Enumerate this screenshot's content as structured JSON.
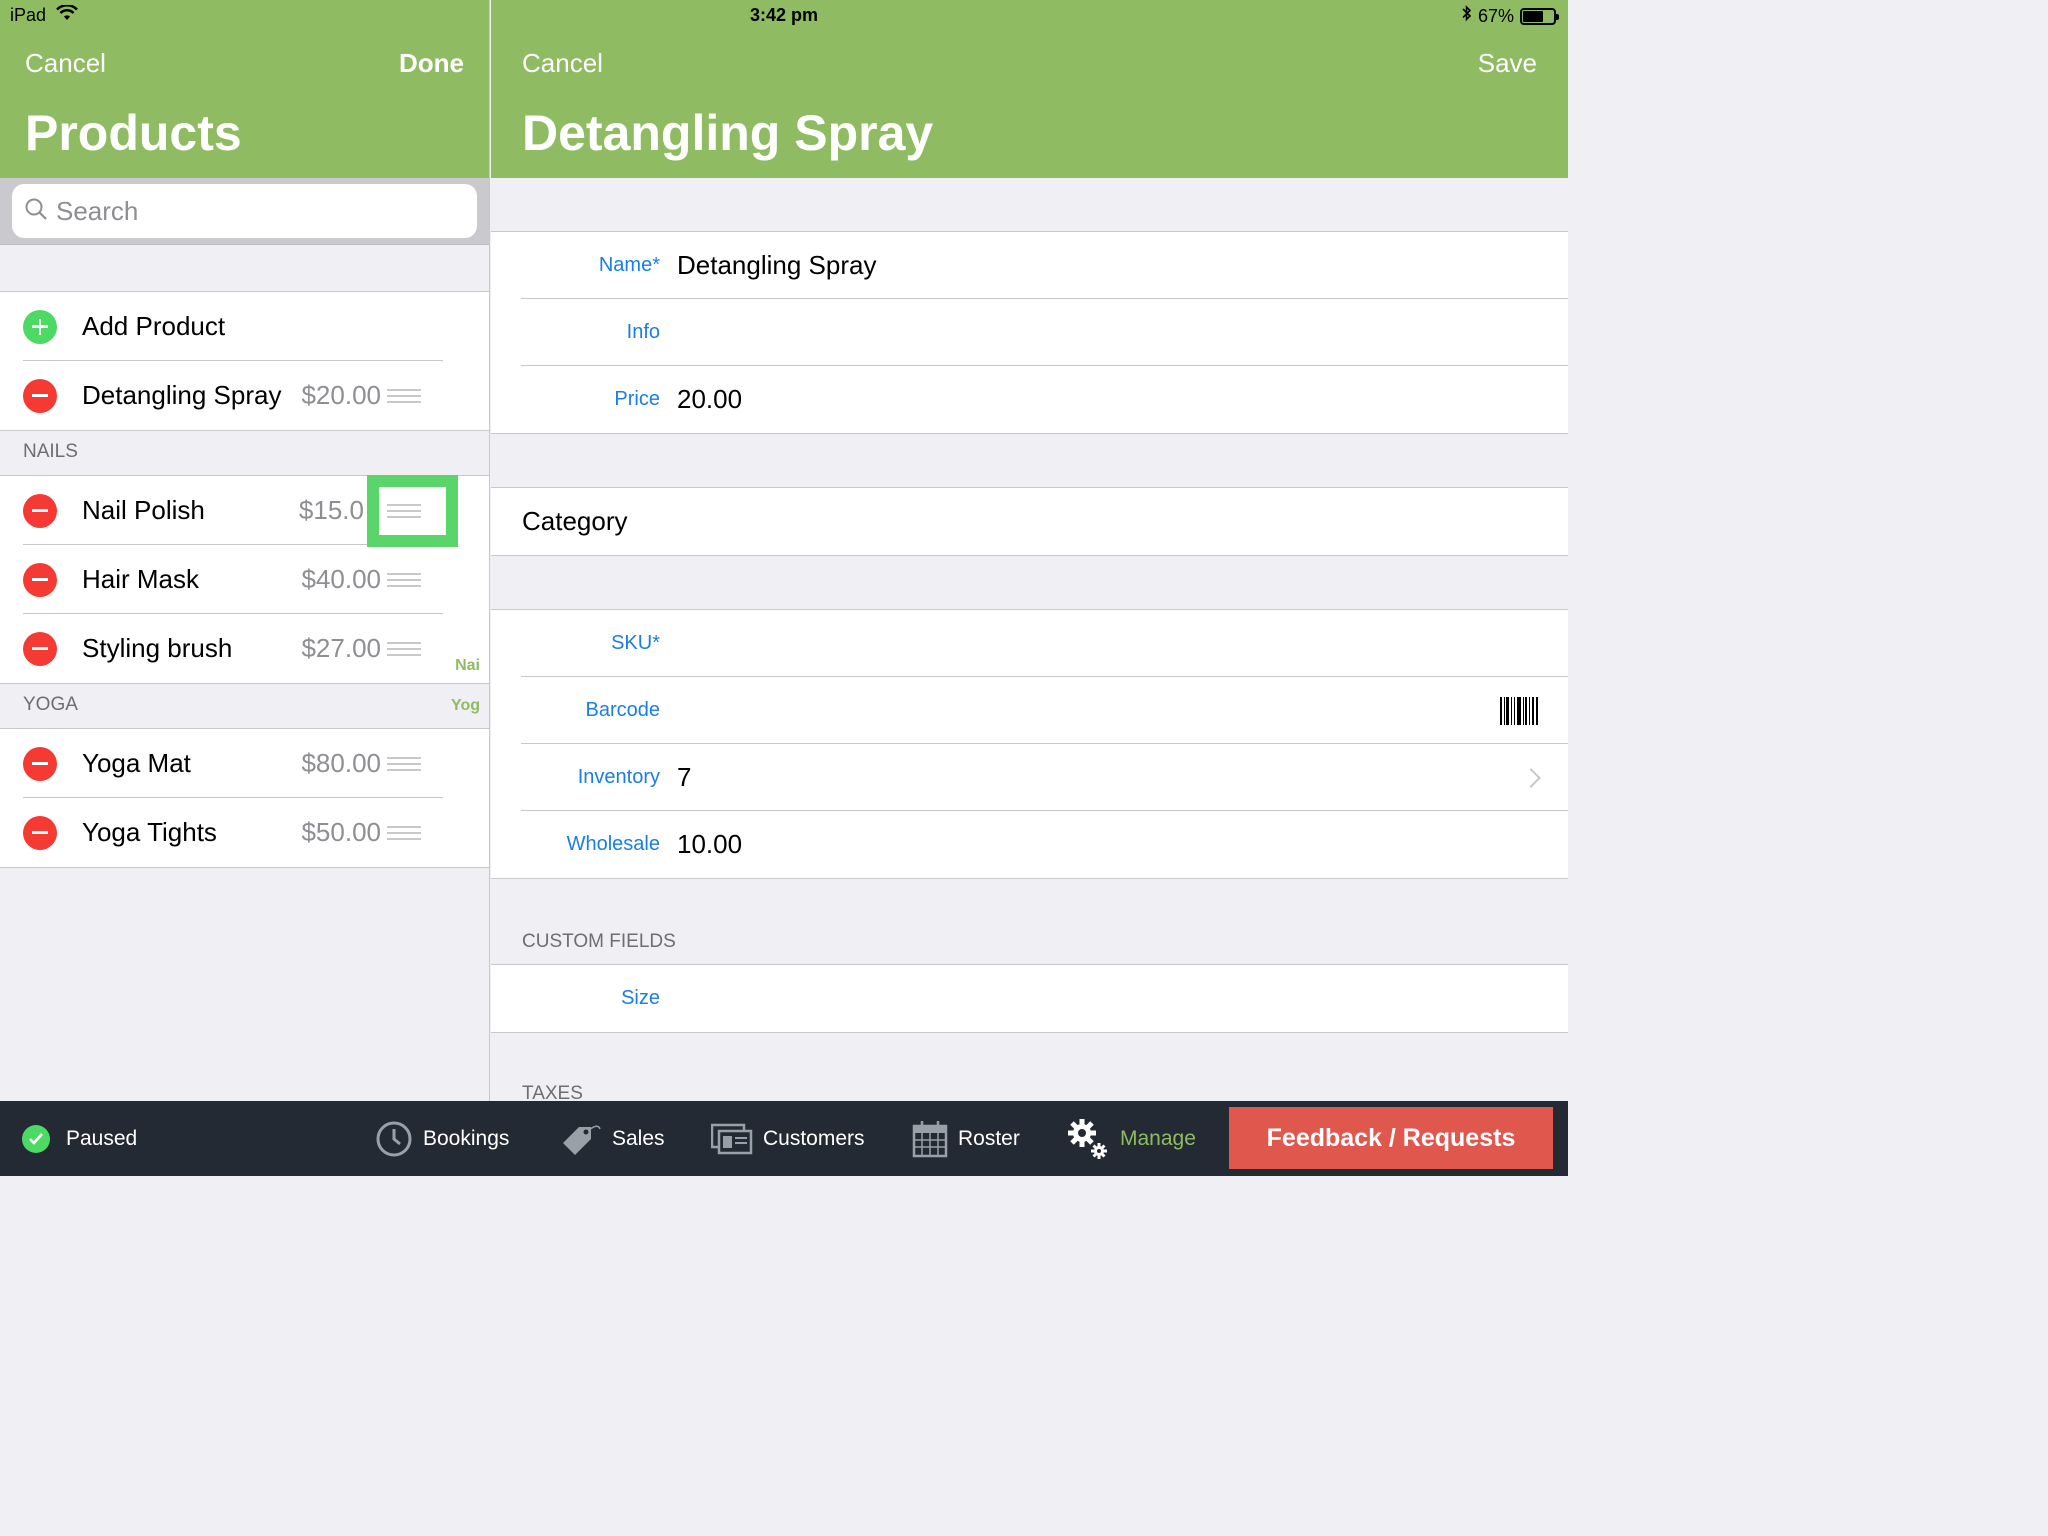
{
  "status_bar": {
    "device": "iPad",
    "time": "3:42 pm",
    "battery": "67%",
    "battery_level": 0.67
  },
  "left": {
    "cancel": "Cancel",
    "done": "Done",
    "title": "Products",
    "search_placeholder": "Search",
    "add_product": "Add Product",
    "ungrouped": [
      {
        "name": "Detangling Spray",
        "price": "$20.00"
      }
    ],
    "sections": [
      {
        "header": "NAILS",
        "items": [
          {
            "name": "Nail Polish",
            "price": "$15.0"
          },
          {
            "name": "Hair Mask",
            "price": "$40.00"
          },
          {
            "name": "Styling brush",
            "price": "$27.00"
          }
        ]
      },
      {
        "header": "YOGA",
        "items": [
          {
            "name": "Yoga Mat",
            "price": "$80.00"
          },
          {
            "name": "Yoga Tights",
            "price": "$50.00"
          }
        ]
      }
    ],
    "index": [
      "Nai",
      "Yog"
    ]
  },
  "right": {
    "cancel": "Cancel",
    "save": "Save",
    "title": "Detangling Spray",
    "fields": {
      "name_label": "Name*",
      "name_value": "Detangling Spray",
      "info_label": "Info",
      "price_label": "Price",
      "price_value": "20.00",
      "category": "Category",
      "sku_label": "SKU*",
      "barcode_label": "Barcode",
      "inventory_label": "Inventory",
      "inventory_value": "7",
      "wholesale_label": "Wholesale",
      "wholesale_value": "10.00",
      "custom_fields_header": "CUSTOM FIELDS",
      "size_label": "Size",
      "taxes_header": "TAXES"
    }
  },
  "tab_bar": {
    "paused": "Paused",
    "bookings": "Bookings",
    "sales": "Sales",
    "customers": "Customers",
    "roster": "Roster",
    "manage": "Manage",
    "feedback": "Feedback / Requests"
  },
  "colors": {
    "nav_green": "#8fbc62",
    "link_blue": "#1a7ee6",
    "delete_red": "#f43a32",
    "add_green": "#4cd964",
    "tab_bar": "#232a33",
    "feedback_red": "#e0574e"
  }
}
